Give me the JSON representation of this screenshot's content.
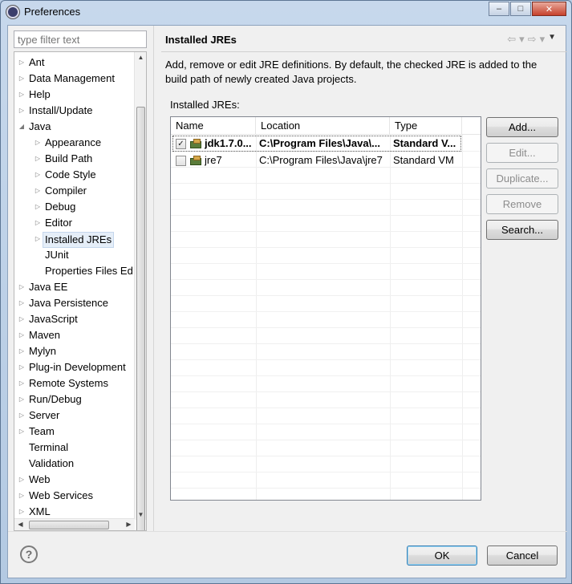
{
  "window": {
    "title": "Preferences",
    "min_glyph": "–",
    "max_glyph": "□",
    "close_glyph": "✕"
  },
  "filter": {
    "placeholder": "type filter text"
  },
  "tree": {
    "items": [
      {
        "label": "Ant",
        "level": 0,
        "expander": "collapsed"
      },
      {
        "label": "Data Management",
        "level": 0,
        "expander": "collapsed"
      },
      {
        "label": "Help",
        "level": 0,
        "expander": "collapsed"
      },
      {
        "label": "Install/Update",
        "level": 0,
        "expander": "collapsed"
      },
      {
        "label": "Java",
        "level": 0,
        "expander": "expanded"
      },
      {
        "label": "Appearance",
        "level": 1,
        "expander": "collapsed"
      },
      {
        "label": "Build Path",
        "level": 1,
        "expander": "collapsed"
      },
      {
        "label": "Code Style",
        "level": 1,
        "expander": "collapsed"
      },
      {
        "label": "Compiler",
        "level": 1,
        "expander": "collapsed"
      },
      {
        "label": "Debug",
        "level": 1,
        "expander": "collapsed"
      },
      {
        "label": "Editor",
        "level": 1,
        "expander": "collapsed"
      },
      {
        "label": "Installed JREs",
        "level": 1,
        "expander": "collapsed",
        "selected": true
      },
      {
        "label": "JUnit",
        "level": 1,
        "expander": "none"
      },
      {
        "label": "Properties Files Ed",
        "level": 1,
        "expander": "none"
      },
      {
        "label": "Java EE",
        "level": 0,
        "expander": "collapsed"
      },
      {
        "label": "Java Persistence",
        "level": 0,
        "expander": "collapsed"
      },
      {
        "label": "JavaScript",
        "level": 0,
        "expander": "collapsed"
      },
      {
        "label": "Maven",
        "level": 0,
        "expander": "collapsed"
      },
      {
        "label": "Mylyn",
        "level": 0,
        "expander": "collapsed"
      },
      {
        "label": "Plug-in Development",
        "level": 0,
        "expander": "collapsed"
      },
      {
        "label": "Remote Systems",
        "level": 0,
        "expander": "collapsed"
      },
      {
        "label": "Run/Debug",
        "level": 0,
        "expander": "collapsed"
      },
      {
        "label": "Server",
        "level": 0,
        "expander": "collapsed"
      },
      {
        "label": "Team",
        "level": 0,
        "expander": "collapsed"
      },
      {
        "label": "Terminal",
        "level": 0,
        "expander": "none"
      },
      {
        "label": "Validation",
        "level": 0,
        "expander": "none"
      },
      {
        "label": "Web",
        "level": 0,
        "expander": "collapsed"
      },
      {
        "label": "Web Services",
        "level": 0,
        "expander": "collapsed"
      },
      {
        "label": "XML",
        "level": 0,
        "expander": "collapsed"
      }
    ]
  },
  "page": {
    "title": "Installed JREs",
    "description": "Add, remove or edit JRE definitions. By default, the checked JRE is added to the build path of newly created Java projects.",
    "list_label": "Installed JREs:",
    "nav": {
      "back": "⇦",
      "back_menu": "▾",
      "forward": "⇨",
      "forward_menu": "▾",
      "view_menu": "▼"
    }
  },
  "table": {
    "columns": [
      "Name",
      "Location",
      "Type"
    ],
    "rows": [
      {
        "checked": true,
        "name": "jdk1.7.0...",
        "location": "C:\\Program Files\\Java\\...",
        "type": "Standard V...",
        "bold": true,
        "selected": true
      },
      {
        "checked": false,
        "name": "jre7",
        "location": "C:\\Program Files\\Java\\jre7",
        "type": "Standard VM",
        "bold": false,
        "selected": false
      }
    ]
  },
  "buttons": {
    "add": "Add...",
    "edit": "Edit...",
    "duplicate": "Duplicate...",
    "remove": "Remove",
    "search": "Search...",
    "ok": "OK",
    "cancel": "Cancel",
    "help": "?"
  }
}
